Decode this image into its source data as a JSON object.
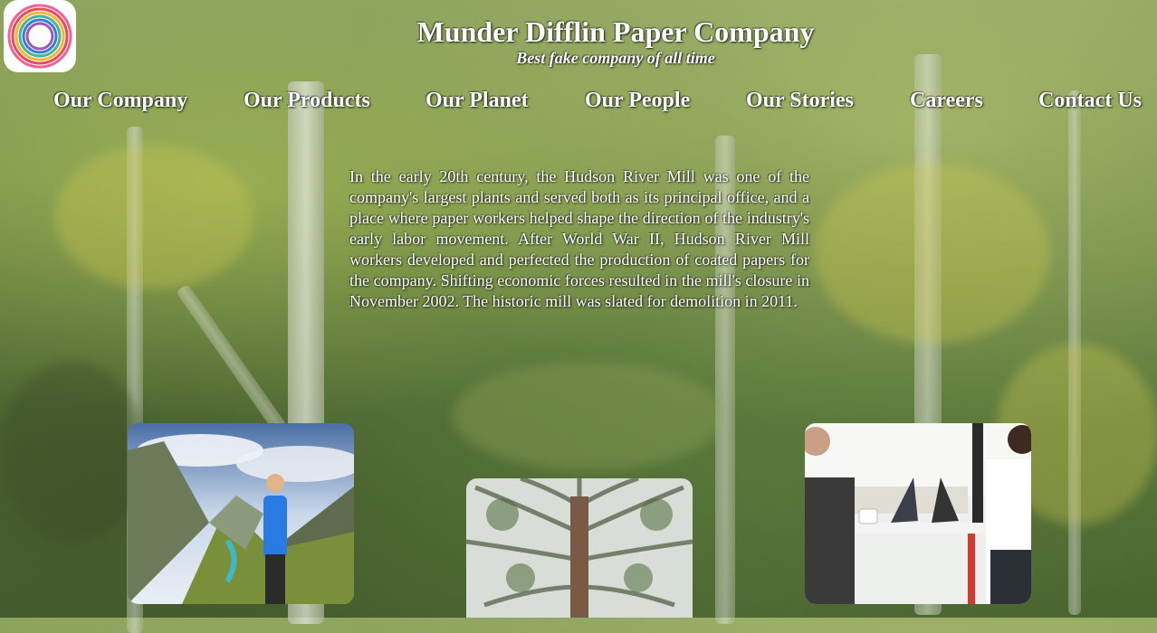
{
  "header": {
    "logo_icon": "swirl-logo-icon",
    "company_name": "Munder Difflin Paper Company",
    "tagline": "Best fake company of all time"
  },
  "nav": {
    "items": [
      {
        "label": "Our Company"
      },
      {
        "label": "Our Products"
      },
      {
        "label": "Our Planet"
      },
      {
        "label": "Our People"
      },
      {
        "label": "Our Stories"
      },
      {
        "label": "Careers"
      },
      {
        "label": "Contact Us"
      }
    ]
  },
  "main": {
    "paragraph": "In the early 20th century, the Hudson River Mill was one of the company's largest plants and served both as its principal office, and a place where paper workers helped shape the direction of the industry's early labor movement. After World War II, Hudson River Mill workers developed and perfected the production of coated papers for the company. Shifting economic forces resulted in the mill's closure in November 2002. The historic mill was slated for demolition in 2011."
  },
  "gallery": {
    "images": [
      {
        "icon": "hiker-mountain-image"
      },
      {
        "icon": "tree-canopy-image"
      },
      {
        "icon": "office-meeting-image"
      }
    ]
  },
  "colors": {
    "text": "#ffffff",
    "background_forest": "#5c7a3c"
  }
}
